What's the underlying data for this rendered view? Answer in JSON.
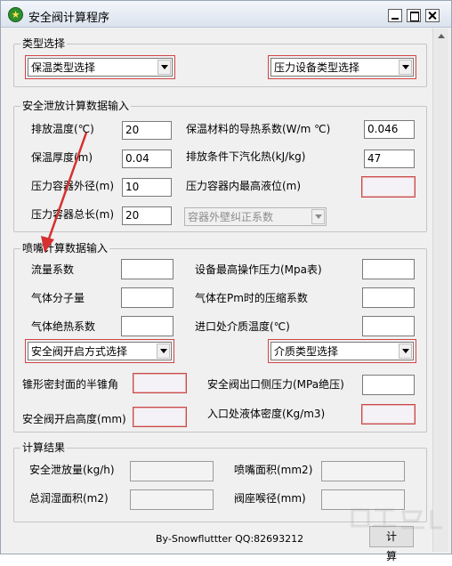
{
  "window": {
    "title": "安全阀计算程序"
  },
  "groups": {
    "type": "类型选择",
    "discharge": "安全泄放计算数据输入",
    "nozzle": "喷嘴计算数据输入",
    "result": "计算结果"
  },
  "type_select": {
    "insulation": "保温类型选择",
    "vessel": "压力设备类型选择"
  },
  "discharge": {
    "temp_label": "排放温度(℃)",
    "temp_value": "20",
    "conductivity_label": "保温材料的导热系数(W/m ℃)",
    "conductivity_value": "0.046",
    "thickness_label": "保温厚度(m)",
    "thickness_value": "0.04",
    "vaporization_label": "排放条件下汽化热(kJ/kg)",
    "vaporization_value": "47",
    "diameter_label": "压力容器外径(m)",
    "diameter_value": "10",
    "level_label": "压力容器内最高液位(m)",
    "level_value": "",
    "length_label": "压力容器总长(m)",
    "length_value": "20",
    "correction_select": "容器外壁纠正系数"
  },
  "nozzle": {
    "flow_coef_label": "流量系数",
    "flow_coef_value": "",
    "max_pressure_label": "设备最高操作压力(Mpa表)",
    "max_pressure_value": "",
    "molecular_label": "气体分子量",
    "molecular_value": "",
    "compress_label": "气体在Pm时的压缩系数",
    "compress_value": "",
    "adiabatic_label": "气体绝热系数",
    "adiabatic_value": "",
    "inlet_temp_label": "进口处介质温度(℃)",
    "inlet_temp_value": "",
    "opening_select": "安全阀开启方式选择",
    "medium_select": "介质类型选择",
    "cone_label": "锥形密封面的半锥角",
    "cone_value": "",
    "outlet_pressure_label": "安全阀出口侧压力(MPa绝压)",
    "outlet_pressure_value": "",
    "lift_label": "安全阀开启高度(mm)",
    "lift_value": "",
    "liquid_density_label": "入口处液体密度(Kg/m3)",
    "liquid_density_value": ""
  },
  "result": {
    "discharge_label": "安全泄放量(kg/h)",
    "discharge_value": "",
    "nozzle_area_label": "喷嘴面积(mm2)",
    "nozzle_area_value": "",
    "wetted_area_label": "总润湿面积(m2)",
    "wetted_area_value": "",
    "throat_label": "阀座喉径(mm)",
    "throat_value": ""
  },
  "footer": {
    "credit": "By-Snowfluttter  QQ:82693212"
  },
  "buttons": {
    "calculate": "计 算"
  },
  "colors": {
    "highlight_border": "#d14545",
    "arrow": "#d63030",
    "window_bg": "#f0f0f0"
  }
}
